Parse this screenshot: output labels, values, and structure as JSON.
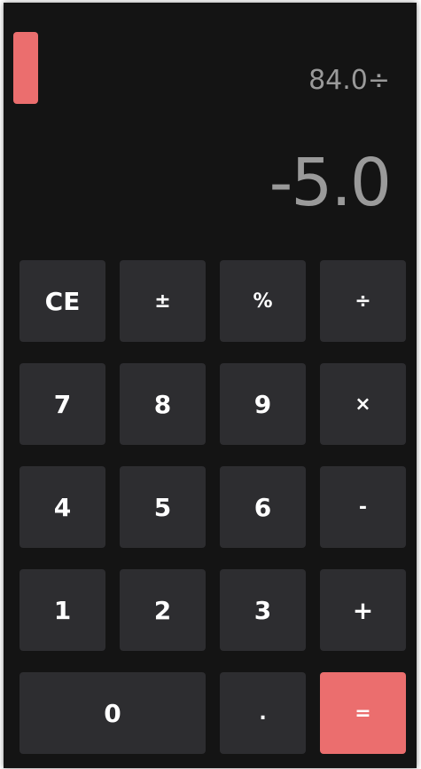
{
  "colors": {
    "accent": "#eb6e6e",
    "key_bg": "#2d2d30",
    "background": "#141414"
  },
  "display": {
    "expression": "84.0÷",
    "result": "-5.0"
  },
  "keys": {
    "ce": "CE",
    "sign": "±",
    "percent": "%",
    "divide": "÷",
    "seven": "7",
    "eight": "8",
    "nine": "9",
    "multiply": "×",
    "four": "4",
    "five": "5",
    "six": "6",
    "minus": "-",
    "one": "1",
    "two": "2",
    "three": "3",
    "plus": "+",
    "zero": "0",
    "dot": ".",
    "equals": "="
  }
}
